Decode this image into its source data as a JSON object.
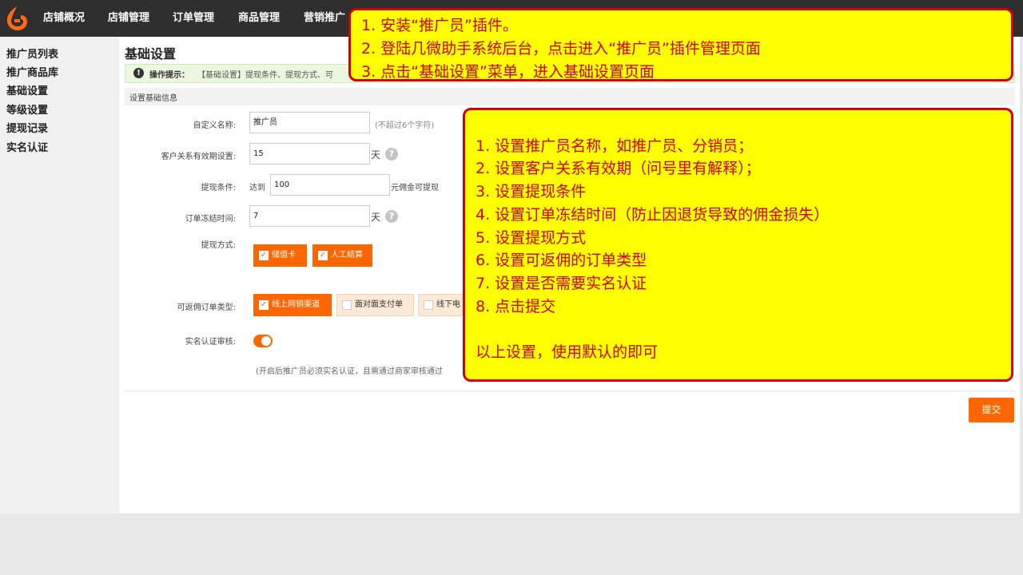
{
  "topnav": {
    "items": [
      "店铺概况",
      "店铺管理",
      "订单管理",
      "商品管理",
      "营销推广"
    ]
  },
  "sidebar": {
    "items": [
      "推广员列表",
      "推广商品库",
      "基础设置",
      "等级设置",
      "提现记录",
      "实名认证"
    ]
  },
  "main": {
    "page_title": "基础设置",
    "tip_label": "操作提示：",
    "tip_text": "【基础设置】提现条件、提现方式、可",
    "section_title": "设置基础信息",
    "fields": {
      "name": {
        "label": "自定义名称:",
        "value": "推广员",
        "hint": "(不超过6个字符)"
      },
      "validity": {
        "label": "客户关系有效期设置:",
        "value": "15",
        "unit": "天"
      },
      "withdraw_condition": {
        "label": "提现条件:",
        "prefix": "达到",
        "value": "100",
        "suffix": "元佣金可提现"
      },
      "freeze_time": {
        "label": "订单冻结时间:",
        "value": "7",
        "unit": "天"
      },
      "withdraw_method": {
        "label": "提现方式:",
        "options": [
          {
            "label": "储值卡",
            "checked": true
          },
          {
            "label": "人工结算",
            "checked": true
          }
        ]
      },
      "order_types": {
        "label": "可返佣订单类型:",
        "options": [
          {
            "label": "线上网销渠道",
            "checked": true
          },
          {
            "label": "面对面支付单",
            "checked": false
          },
          {
            "label": "线下电",
            "checked": false
          }
        ]
      },
      "realname": {
        "label": "实名认证审核:",
        "enabled": true,
        "hint": "(开启后推广员必须实名认证，且需通过商家审核通过"
      }
    },
    "submit_label": "提交"
  },
  "callout_top": {
    "lines": [
      "1. 安装“推广员”插件。",
      "2. 登陆几微助手系统后台，点击进入“推广员”插件管理页面",
      "3. 点击“基础设置”菜单，进入基础设置页面"
    ]
  },
  "callout_right": {
    "lines": [
      "1. 设置推广员名称，如推广员、分销员；",
      "2. 设置客户关系有效期（问号里有解释）；",
      "3. 设置提现条件",
      "4. 设置订单冻结时间（防止因退货导致的佣金损失）",
      "5. 设置提现方式",
      "6. 设置可返佣的订单类型",
      "7. 设置是否需要实名认证",
      "8. 点击提交",
      "以上设置，使用默认的即可"
    ]
  },
  "colors": {
    "accent": "#ff6600",
    "callout_bg": "#ffff00",
    "callout_border": "#d40000",
    "topbar": "#2f2f2f"
  },
  "icons": [
    "logo-icon",
    "info-icon",
    "help-icon",
    "check-icon",
    "toggle-icon"
  ]
}
